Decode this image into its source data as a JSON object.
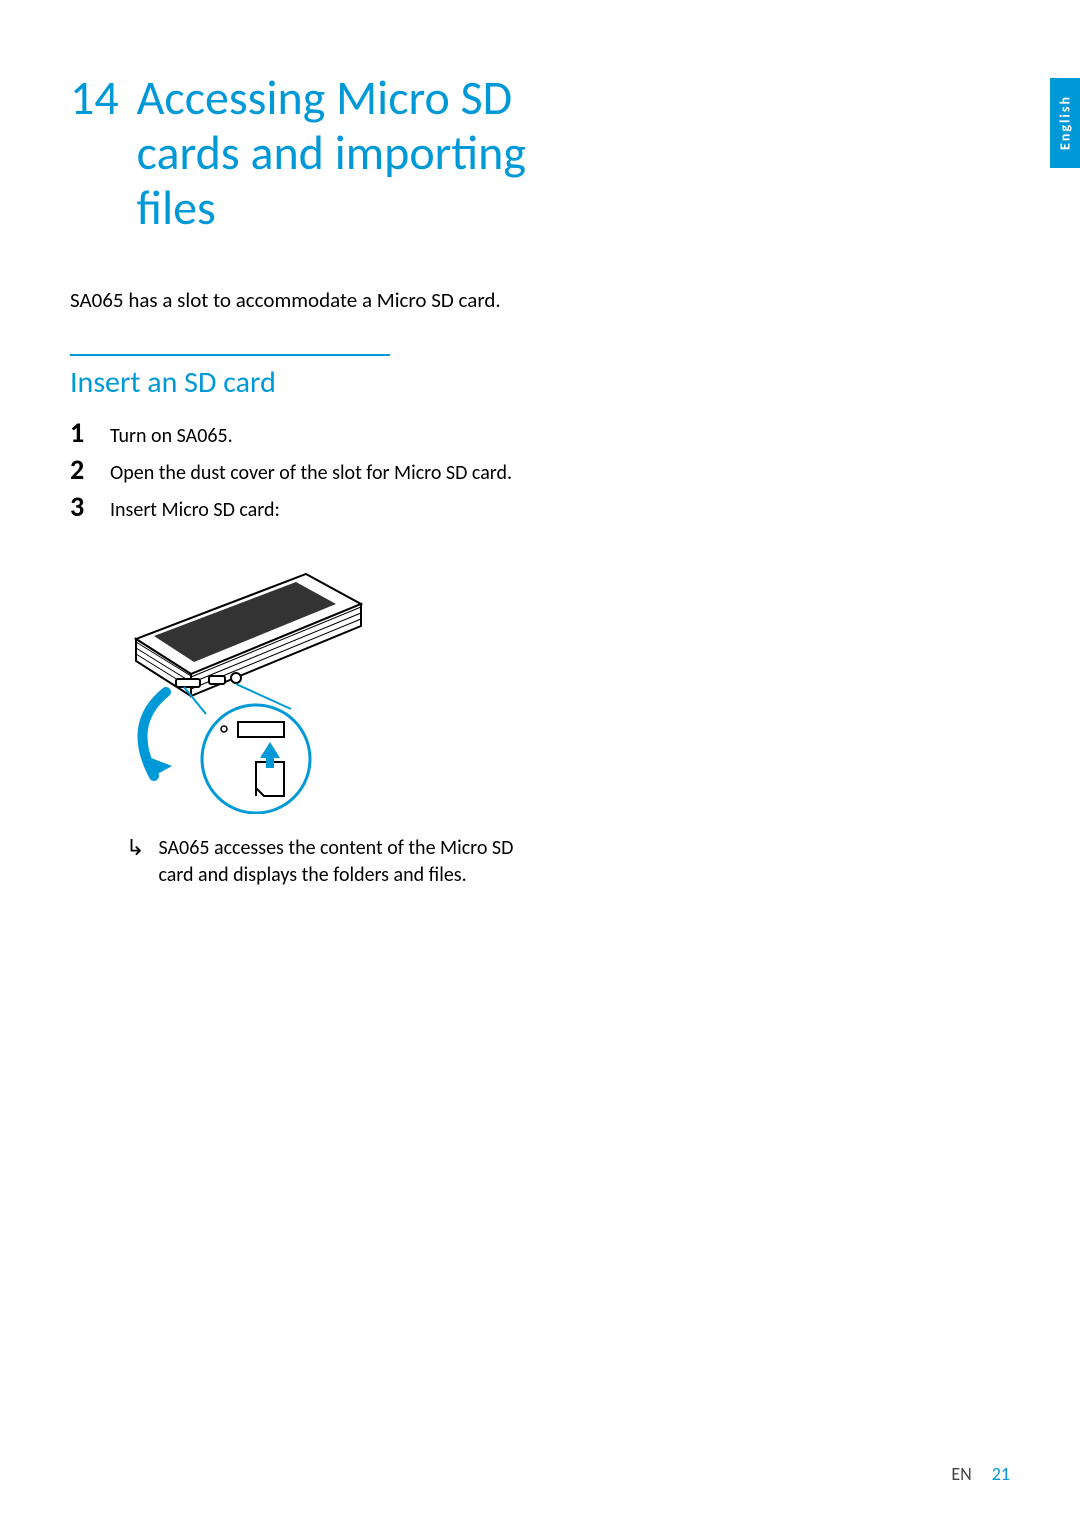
{
  "lang_tab": "English",
  "chapter": {
    "number": "14",
    "title": "Accessing Micro SD cards and importing files"
  },
  "intro": "SA065 has a slot to accommodate a Micro SD card.",
  "section_title": "Insert an SD card",
  "steps": [
    {
      "n": "1",
      "text": "Turn on SA065."
    },
    {
      "n": "2",
      "text": "Open the dust cover of the slot for Micro SD card."
    },
    {
      "n": "3",
      "text": "Insert Micro SD card:"
    }
  ],
  "result": "SA065 accesses the content of the Micro SD card and displays the folders and files.",
  "footer": {
    "lang": "EN",
    "page": "21"
  }
}
